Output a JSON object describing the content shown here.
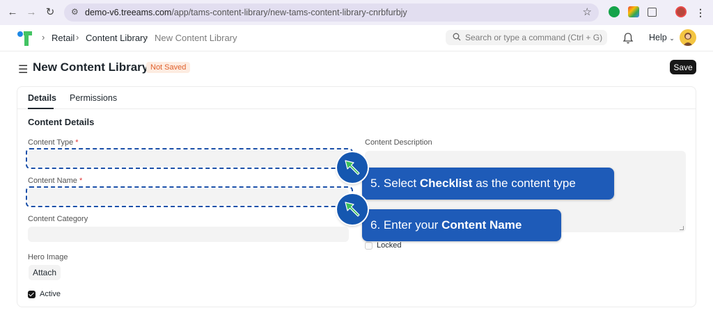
{
  "browser": {
    "url_domain": "demo-v6.treeams.com",
    "url_path": "/app/tams-content-library/new-tams-content-library-cnrbfurbjy"
  },
  "nav": {
    "breadcrumbs": [
      "Retail",
      "Content Library",
      "New Content Library"
    ],
    "search_placeholder": "Search or type a command (Ctrl + G)",
    "help_label": "Help"
  },
  "header": {
    "title": "New Content Library",
    "status_badge": "Not Saved",
    "save_label": "Save"
  },
  "tabs": [
    {
      "label": "Details",
      "active": true
    },
    {
      "label": "Permissions",
      "active": false
    }
  ],
  "form": {
    "section_title": "Content Details",
    "content_type_label": "Content Type",
    "content_type_value": "",
    "content_name_label": "Content Name",
    "content_name_value": "",
    "content_category_label": "Content Category",
    "content_category_value": "",
    "content_description_label": "Content Description",
    "hero_image_label": "Hero Image",
    "attach_label": "Attach",
    "active_label": "Active",
    "active_checked": true,
    "locked_label": "Locked",
    "locked_checked": false,
    "required_marker": "*"
  },
  "callouts": [
    {
      "prefix": "5. Select ",
      "bold": "Checklist",
      "suffix": " as the content type"
    },
    {
      "prefix": "6. Enter your ",
      "bold": "Content Name",
      "suffix": ""
    }
  ],
  "colors": {
    "callout_bg": "#1e5bb8",
    "pointer_arrow": "#3ac15a",
    "highlight_dash": "#1a4fa8",
    "badge_text": "#e0612d",
    "badge_bg": "#fdece1"
  }
}
